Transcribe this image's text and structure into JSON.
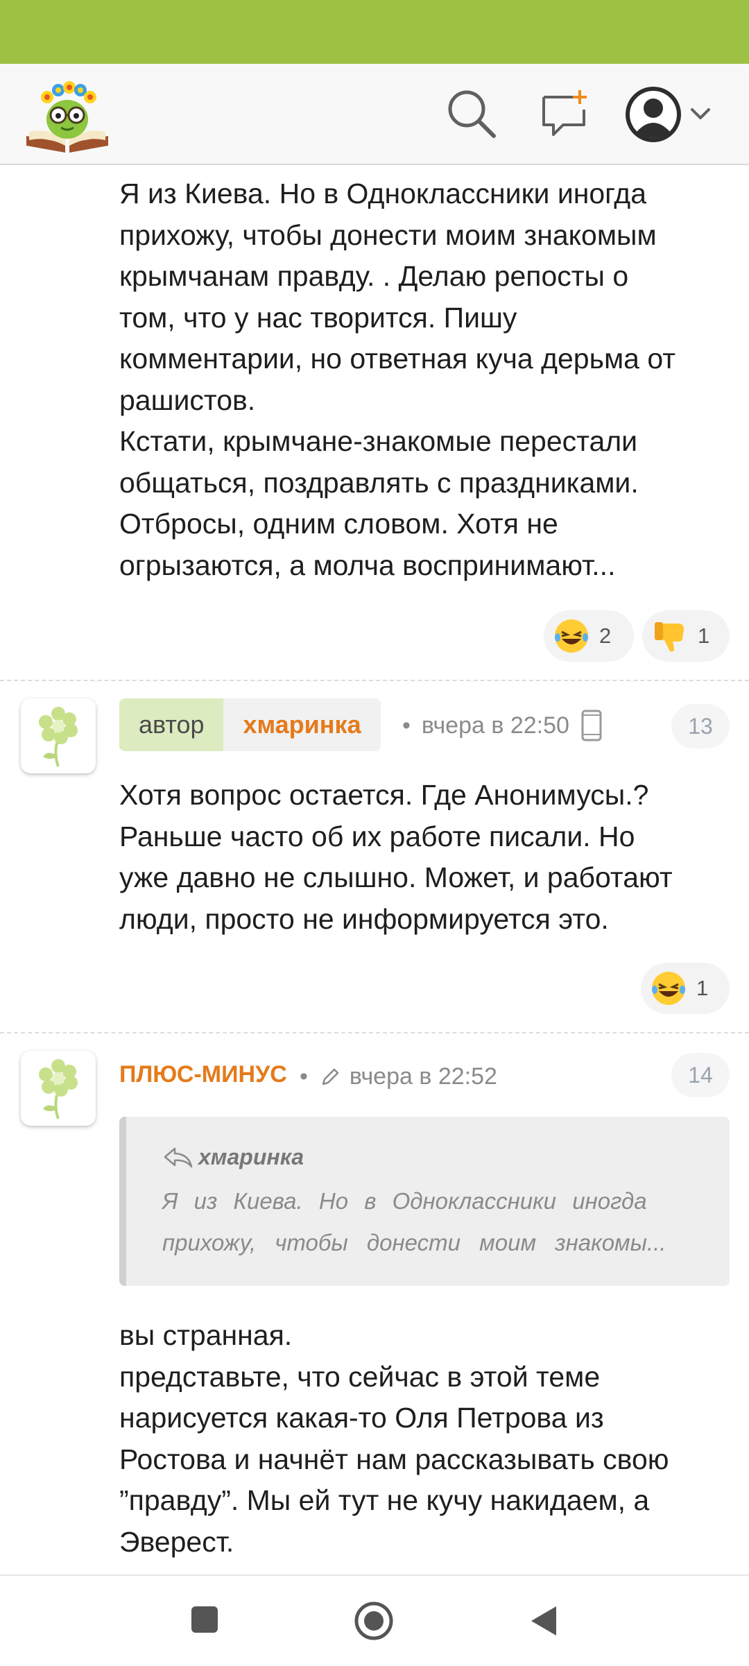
{
  "header": {
    "logo_name": "site-logo",
    "icons": [
      "search-icon",
      "new-message-icon",
      "user-avatar-icon",
      "chevron-down-icon"
    ]
  },
  "comment_top": {
    "lines": [
      "Я из Киева. Но в Одноклассники иногда",
      "прихожу, чтобы донести моим знакомым",
      "крымчанам правду. . Делаю репосты о",
      "том, что у нас творится. Пишу",
      "комментарии, но ответная куча дерьма от",
      "рашистов.",
      "Кстати, крымчане-знакомые перестали",
      "общаться, поздравлять с праздниками.",
      "Отбросы, одним словом. Хотя не",
      "огрызаются, а молча воспринимают..."
    ],
    "reactions": [
      {
        "icon": "laughing-emoji-icon",
        "count": "2"
      },
      {
        "icon": "thumbs-down-emoji-icon",
        "count": "1"
      }
    ]
  },
  "comment_13": {
    "role_label": "автор",
    "username": "хмаринка",
    "separator": "•",
    "time": "вчера в 22:50",
    "number": "13",
    "lines": [
      "Хотя вопрос остается. Где Анонимусы.?",
      "Раньше часто об их работе писали. Но",
      "уже давно не слышно. Может, и работают",
      "люди, просто не информируется это."
    ],
    "reactions": [
      {
        "icon": "laughing-emoji-icon",
        "count": "1"
      }
    ]
  },
  "comment_14": {
    "username": "ПЛЮС-МИНУС",
    "separator": "•",
    "time": "вчера в 22:52",
    "number": "14",
    "quote": {
      "author": "хмаринка",
      "lines": [
        "Я из Киева. Но в Одноклассники иногда",
        "прихожу, чтобы донести моим знакомы..."
      ]
    },
    "lines": [
      "вы странная.",
      "представьте, что сейчас в этой теме",
      "нарисуется какая-то Оля Петрова из",
      "Ростова и начнёт нам рассказывать свою",
      "”правду”. Мы ей тут не кучу накидаем, а",
      "Эверест."
    ]
  },
  "colors": {
    "status_bar": "#9dc243",
    "username": "#e57a1a",
    "author_badge": "#dcebc0"
  }
}
